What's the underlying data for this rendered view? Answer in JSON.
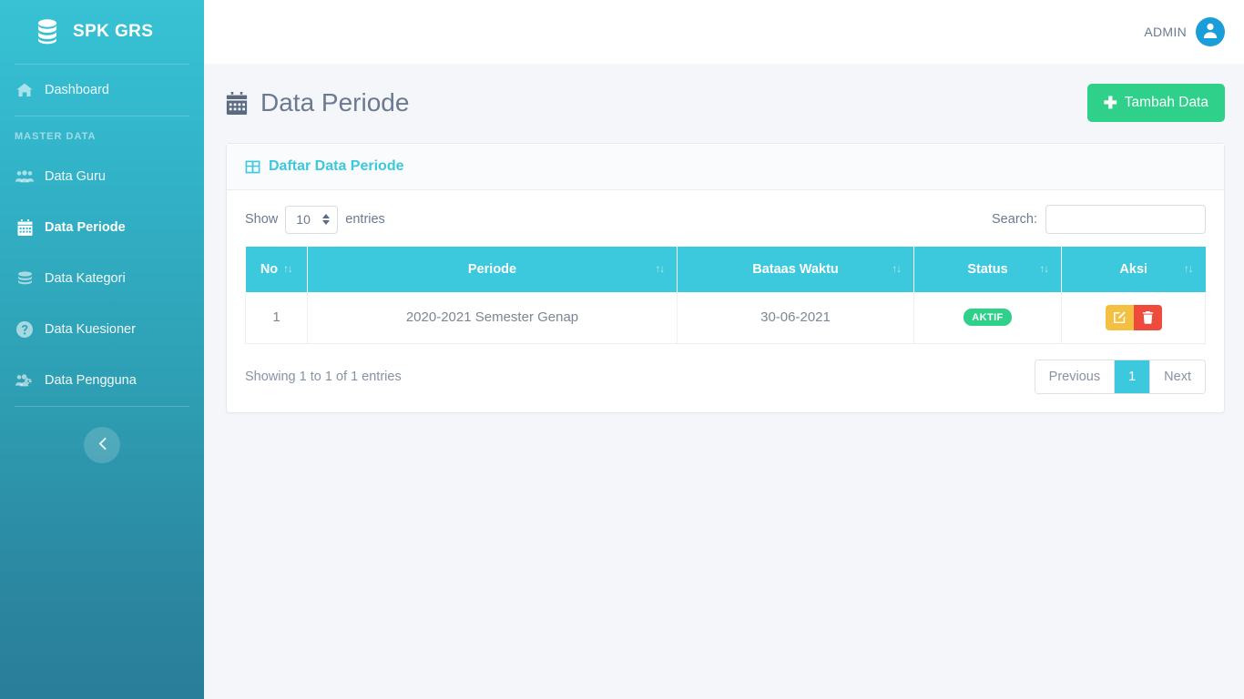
{
  "brand": {
    "name": "SPK GRS",
    "logo_icon": "database-icon"
  },
  "sidebar": {
    "dashboard": {
      "label": "Dashboard",
      "icon": "home-icon"
    },
    "section_label": "MASTER DATA",
    "items": [
      {
        "label": "Data Guru",
        "icon": "users-icon",
        "active": false
      },
      {
        "label": "Data Periode",
        "icon": "calendar-icon",
        "active": true
      },
      {
        "label": "Data Kategori",
        "icon": "layers-icon",
        "active": false
      },
      {
        "label": "Data Kuesioner",
        "icon": "question-circle-icon",
        "active": false
      },
      {
        "label": "Data Pengguna",
        "icon": "users-cog-icon",
        "active": false
      }
    ],
    "collapse_icon": "chevron-left-icon"
  },
  "topbar": {
    "user_name": "ADMIN",
    "avatar_icon": "user-avatar-icon"
  },
  "page": {
    "title": "Data Periode",
    "title_icon": "calendar-icon",
    "add_button": {
      "label": "Tambah Data",
      "icon": "plus-icon"
    }
  },
  "card": {
    "header": {
      "title": "Daftar Data Periode",
      "icon": "table-icon"
    },
    "tools": {
      "show_label": "Show",
      "entries_label": "entries",
      "page_length": "10",
      "search_label": "Search:",
      "search_value": "",
      "search_placeholder": ""
    },
    "table": {
      "columns": [
        {
          "label": "No",
          "sort": "↑↓"
        },
        {
          "label": "Periode",
          "sort": "↑↓"
        },
        {
          "label": "Bataas Waktu",
          "sort": "↑↓"
        },
        {
          "label": "Status",
          "sort": "↑↓"
        },
        {
          "label": "Aksi",
          "sort": "↑↓"
        }
      ],
      "rows": [
        {
          "no": "1",
          "periode": "2020-2021 Semester Genap",
          "batas_waktu": "30-06-2021",
          "status": "AKTIF",
          "actions": [
            {
              "name": "edit-button",
              "icon": "pencil-square-icon"
            },
            {
              "name": "delete-button",
              "icon": "trash-icon"
            }
          ]
        }
      ]
    },
    "footer": {
      "info": "Showing 1 to 1 of 1 entries",
      "pagination": {
        "previous": "Previous",
        "pages": [
          "1"
        ],
        "next": "Next",
        "active_page": "1"
      }
    }
  },
  "colors": {
    "sidebar_top": "#38c2d4",
    "sidebar_bottom": "#297e99",
    "accent_teal": "#3cc8dd",
    "success_green": "#2fd08a",
    "edit_yellow": "#f4c041",
    "delete_red": "#ef4b3c",
    "page_background": "#f4f6fa",
    "avatar_blue": "#1b9dd9"
  }
}
